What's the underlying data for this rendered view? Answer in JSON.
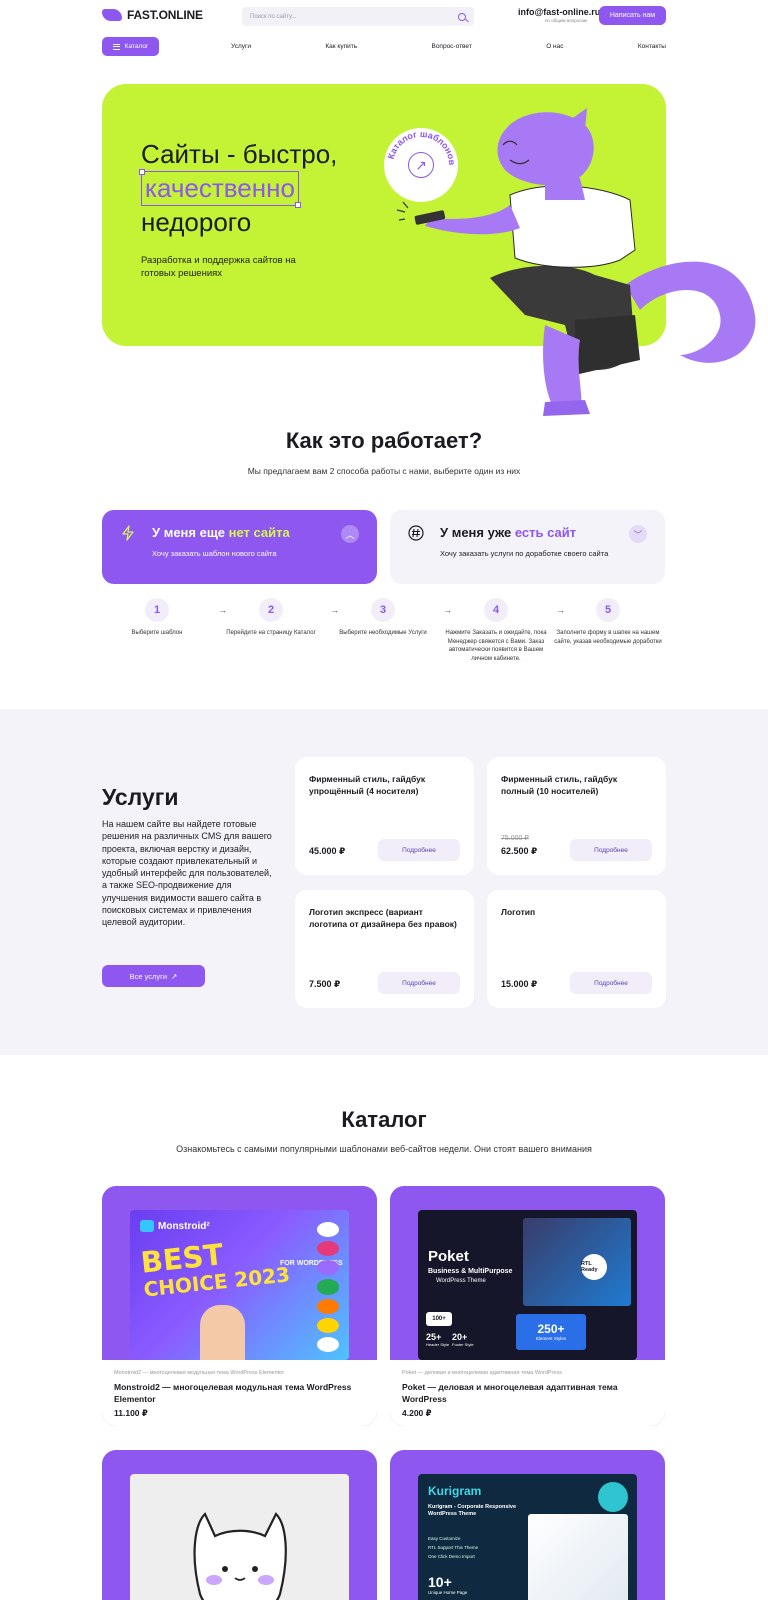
{
  "header": {
    "logo_text": "FAST.ONLINE",
    "search_placeholder": "Поиск по сайту...",
    "email": "info@fast-online.ru",
    "email_caption": "по общим вопросам",
    "write_button": "Написать нам",
    "catalog_button": "Каталог",
    "nav": [
      "Услуги",
      "Как купить",
      "Вопрос-ответ",
      "О нас",
      "Контакты"
    ]
  },
  "hero": {
    "title_line1": "Сайты - быстро,",
    "title_line2": "качественно",
    "title_line3": "недорого",
    "subtitle": "Разработка и поддержка сайтов на готовых решениях",
    "badge_text": "Каталог шаблонов"
  },
  "how": {
    "title": "Как это работает?",
    "subtitle": "Мы предлагаем вам 2 способа работы с нами, выберите один из них",
    "options": [
      {
        "title_prefix": "У меня еще ",
        "title_highlight": "нет сайта",
        "subtitle": "Хочу заказать шаблон нового сайта"
      },
      {
        "title_prefix": "У меня уже ",
        "title_highlight": "есть сайт",
        "subtitle": "Хочу заказать услуги по доработке своего сайта"
      }
    ],
    "steps": [
      {
        "num": "1",
        "text": "Выберите шаблон"
      },
      {
        "num": "2",
        "text": "Перейдите на страницу Каталог"
      },
      {
        "num": "3",
        "text": "Выберите необходимые Услуги"
      },
      {
        "num": "4",
        "text": "Нажмите Заказать и ожидайте, пока Менеджер свяжется с Вами. Заказ автоматически появится в Вашем личном кабинете."
      },
      {
        "num": "5",
        "text": "Заполните форму в шапке на нашем сайте, указав необходимые доработки"
      }
    ]
  },
  "services": {
    "title": "Услуги",
    "text": "На нашем сайте вы найдете готовые решения на различных CMS для вашего проекта, включая верстку и дизайн, которые создают привлекательный и удобный интерфейс для пользователей, а также SEO-продвижение для улучшения видимости вашего сайта в поисковых системах и привлечения целевой аудитории.",
    "all_button": "Все услуги",
    "cards": [
      {
        "title": "Фирменный стиль, гайдбук упрощённый (4 носителя)",
        "old_price": "",
        "price": "45.000 ₽",
        "button": "Подробнее"
      },
      {
        "title": "Фирменный стиль, гайдбук полный (10 носителей)",
        "old_price": "75.000 ₽",
        "price": "62.500 ₽",
        "button": "Подробнее"
      },
      {
        "title": "Логотип экспресс (вариант логотипа от дизайнера без правок)",
        "old_price": "",
        "price": "7.500 ₽",
        "button": "Подробнее"
      },
      {
        "title": "Логотип",
        "old_price": "",
        "price": "15.000 ₽",
        "button": "Подробнее"
      }
    ]
  },
  "catalog": {
    "title": "Каталог",
    "subtitle": "Ознакомьтесь с самыми популярными шаблонами веб-сайтов недели. Они стоят вашего внимания",
    "products": [
      {
        "caption": "Monstroid2 — многоцелевая модульная тема WordPress Elementor",
        "name": "Monstroid2 — многоцелевая модульная тема WordPress Elementor",
        "price": "11.100 ₽",
        "img_brand": "Monstroid²",
        "img_line1": "BEST",
        "img_line2": "CHOICE 2023",
        "img_tag": "FOR WORDPRESS"
      },
      {
        "caption": "Poket — деловая и многоцелевая адаптивная тема WordPress",
        "name": "Poket — деловая и многоцелевая адаптивная тема WordPress",
        "price": "4.200 ₽",
        "img_brand": "Poket",
        "img_line1": "Business & MultiPurpose",
        "img_line2": "WordPress Theme",
        "img_stat1": "25+",
        "img_stat2": "20+",
        "img_stat3": "250+",
        "img_stat1_label": "Header Style",
        "img_stat2_label": "Footer Style",
        "img_stat3_label": "Element Styles",
        "img_demo": "100+",
        "img_rtl": "RTL Ready"
      },
      {
        "caption": "",
        "name": "",
        "price": ""
      },
      {
        "caption": "",
        "name": "",
        "price": "",
        "img_brand": "Kurigram",
        "img_line1": "Kurigram - Corporate Responsive WordPress Theme",
        "img_feat1": "Easy Customize",
        "img_feat2": "RTL Support This Theme",
        "img_feat3": "One Click Demo Import",
        "img_stat": "10+",
        "img_stat_label": "Unique Home Page"
      }
    ]
  },
  "colors": {
    "accent": "#8d57f0",
    "lime": "#c3f334",
    "light_bg": "#f4f3f9"
  }
}
